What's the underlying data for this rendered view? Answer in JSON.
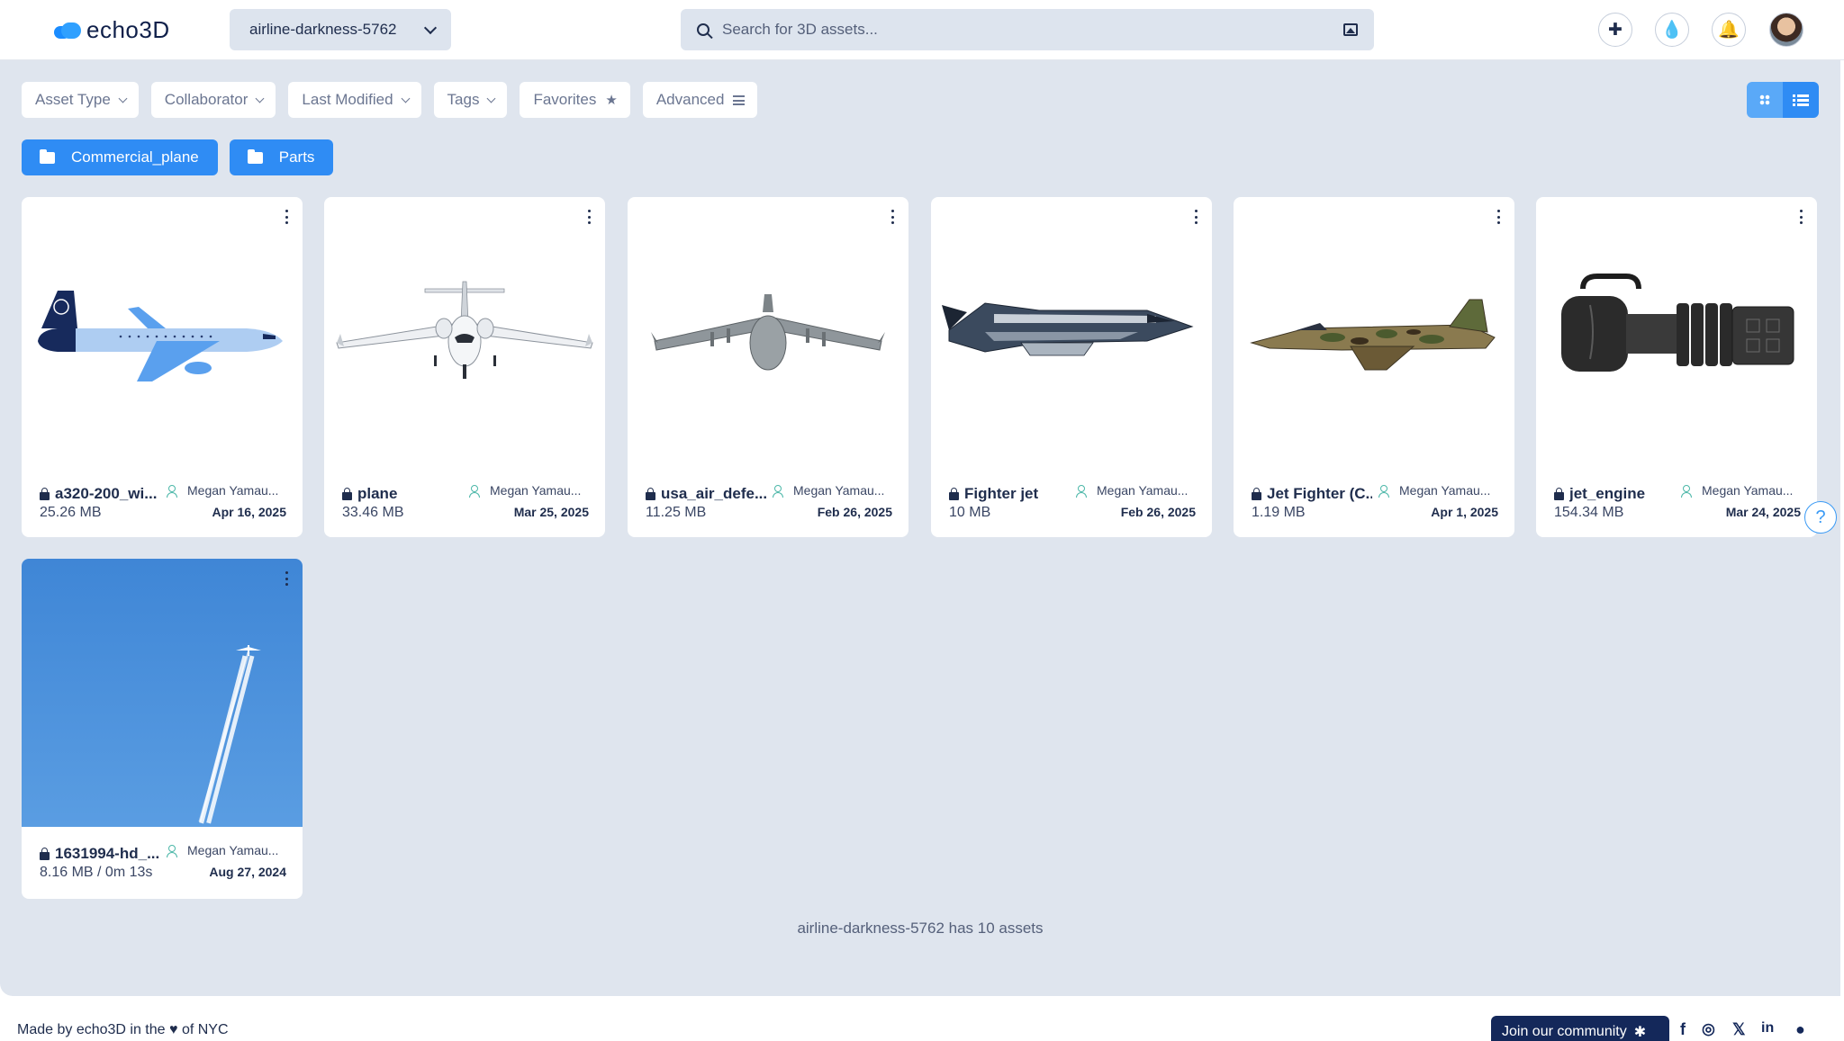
{
  "app": {
    "name": "echo3D",
    "brand_color": "#2f8cf4"
  },
  "header": {
    "project": "airline-darkness-5762",
    "search_placeholder": "Search for 3D assets...",
    "icons": [
      "puzzle-icon",
      "drop-icon",
      "bell-icon",
      "avatar"
    ]
  },
  "filters": [
    "Asset Type",
    "Collaborator",
    "Last Modified",
    "Tags",
    "Favorites",
    "Advanced"
  ],
  "folders": [
    "Commercial_plane",
    "Parts"
  ],
  "cards": [
    {
      "name": "a320-200_wi...",
      "size": "25.26 MB",
      "collaborator": "Megan Yamau...",
      "date": "Apr 16, 2025",
      "thumb": "airliner"
    },
    {
      "name": "plane",
      "size": "33.46 MB",
      "collaborator": "Megan Yamau...",
      "date": "Mar 25, 2025",
      "thumb": "jet-front"
    },
    {
      "name": "usa_air_defe...",
      "size": "11.25 MB",
      "collaborator": "Megan Yamau...",
      "date": "Feb 26, 2025",
      "thumb": "cargo-plane"
    },
    {
      "name": "Fighter jet",
      "size": "10 MB",
      "collaborator": "Megan Yamau...",
      "date": "Feb 26, 2025",
      "thumb": "fighter-jet"
    },
    {
      "name": "Jet Fighter (C...",
      "size": "1.19 MB",
      "collaborator": "Megan Yamau...",
      "date": "Apr 1, 2025",
      "thumb": "camo-jet"
    },
    {
      "name": "jet_engine",
      "size": "154.34 MB",
      "collaborator": "Megan Yamau...",
      "date": "Mar 24, 2025",
      "thumb": "jet-engine"
    },
    {
      "name": "1631994-hd_...",
      "size": "8.16 MB / 0m 13s",
      "collaborator": "Megan Yamau...",
      "date": "Aug 27, 2024",
      "thumb": "sky-video"
    }
  ],
  "summary": "airline-darkness-5762 has 10 assets",
  "footer": {
    "made_by_pre": "Made by echo3D in the",
    "made_by_post": "of NYC",
    "join": "Join our community",
    "social": [
      "f",
      "ig",
      "x",
      "in",
      "gh"
    ]
  }
}
